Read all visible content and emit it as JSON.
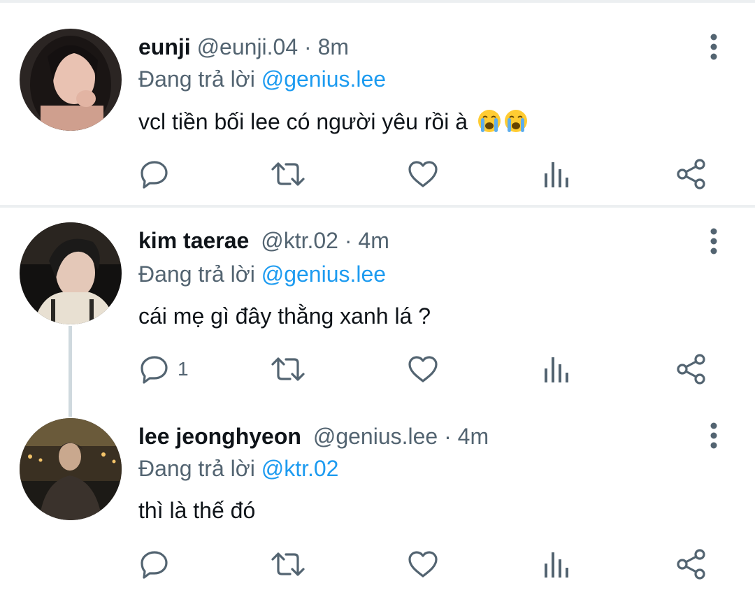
{
  "tweets": [
    {
      "display_name": "eunji",
      "handle": "@eunji.04",
      "dot": "·",
      "time": "8m",
      "reply_prefix": "Đang trả lời",
      "reply_to": "@genius.lee",
      "text": "vcl tiền bối lee có người yêu rồi à",
      "emoji": [
        "loudly-crying-face-emoji",
        "loudly-crying-face-emoji"
      ],
      "reply_count": ""
    },
    {
      "display_name": "kim taerae",
      "handle": "@ktr.02",
      "dot": "·",
      "time": "4m",
      "reply_prefix": "Đang trả lời",
      "reply_to": "@genius.lee",
      "text": "cái mẹ gì đây thằng xanh lá ?",
      "reply_count": "1"
    },
    {
      "display_name": "lee jeonghyeon",
      "handle": "@genius.lee",
      "dot": "·",
      "time": "4m",
      "reply_prefix": "Đang trả lời",
      "reply_to": "@ktr.02",
      "text": "thì là thế đó",
      "reply_count": ""
    }
  ],
  "icons": {
    "reply": "reply-icon",
    "retweet": "retweet-icon",
    "like": "like-icon",
    "analytics": "analytics-icon",
    "share": "share-icon",
    "more": "more-vertical-icon"
  },
  "colors": {
    "text": "#0f1419",
    "secondary": "#536471",
    "mention": "#1d9bf0",
    "divider": "#eceff1",
    "thread_line": "#cfd9de"
  }
}
